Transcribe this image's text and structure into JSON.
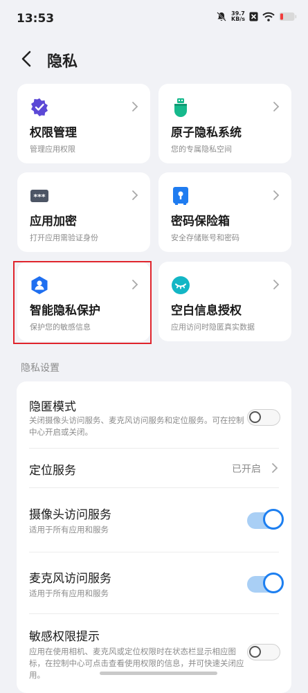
{
  "status": {
    "time": "13:53",
    "net_speed": "39.7",
    "net_unit": "KB/s"
  },
  "header": {
    "title": "隐私"
  },
  "tiles": [
    {
      "name": "权限管理",
      "sub": "管理应用权限"
    },
    {
      "name": "原子隐私系统",
      "sub": "您的专属隐私空间"
    },
    {
      "name": "应用加密",
      "sub": "打开应用需验证身份"
    },
    {
      "name": "密码保险箱",
      "sub": "安全存储账号和密码"
    },
    {
      "name": "智能隐私保护",
      "sub": "保护您的敏感信息"
    },
    {
      "name": "空白信息授权",
      "sub": "应用访问时隐匿真实数据"
    }
  ],
  "settings": {
    "section_label": "隐私设置",
    "rows": [
      {
        "name": "隐匿模式",
        "desc": "关闭摄像头访问服务、麦克风访问服务和定位服务。可在控制中心开启或关闭。",
        "state": "off"
      },
      {
        "name": "定位服务",
        "value": "已开启"
      },
      {
        "name": "摄像头访问服务",
        "desc": "适用于所有应用和服务",
        "state": "on"
      },
      {
        "name": "麦克风访问服务",
        "desc": "适用于所有应用和服务",
        "state": "on"
      },
      {
        "name": "敏感权限提示",
        "desc": "应用在使用相机、麦克风或定位权限时在状态栏显示相应图标，在控制中心可点击查看使用权限的信息，并可快速关闭应用。",
        "state": "off"
      }
    ]
  },
  "colors": {
    "accent": "#1d7ff0",
    "highlight_border": "#e0242c",
    "background": "#f1f2f6"
  }
}
